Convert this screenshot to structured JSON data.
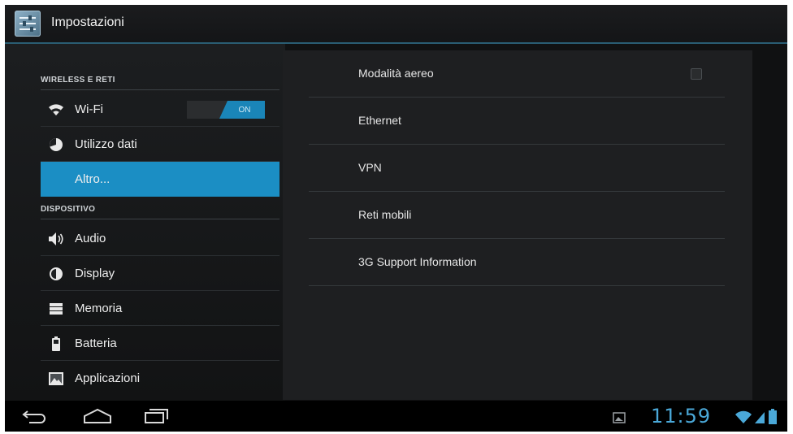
{
  "actionbar": {
    "title": "Impostazioni",
    "icon": "settings-sliders-icon"
  },
  "wireless": {
    "header": "WIRELESS E RETI",
    "wifi_label": "Wi-Fi",
    "wifi_toggle": "ON",
    "data_usage_label": "Utilizzo dati",
    "more_label": "Altro..."
  },
  "device": {
    "header": "DISPOSITIVO",
    "items": [
      {
        "label": "Audio",
        "icon": "speaker-icon"
      },
      {
        "label": "Display",
        "icon": "brightness-icon"
      },
      {
        "label": "Memoria",
        "icon": "storage-icon"
      },
      {
        "label": "Batteria",
        "icon": "battery-icon"
      },
      {
        "label": "Applicazioni",
        "icon": "apps-icon"
      }
    ]
  },
  "detail": {
    "items": [
      {
        "label": "Modalità aereo",
        "checkbox": false
      },
      {
        "label": "Ethernet"
      },
      {
        "label": "VPN"
      },
      {
        "label": "Reti mobili"
      },
      {
        "label": "3G Support Information"
      }
    ]
  },
  "statusbar": {
    "time": "11:59"
  },
  "colors": {
    "accent": "#1b8ec4",
    "clock": "#4aa8d8"
  }
}
